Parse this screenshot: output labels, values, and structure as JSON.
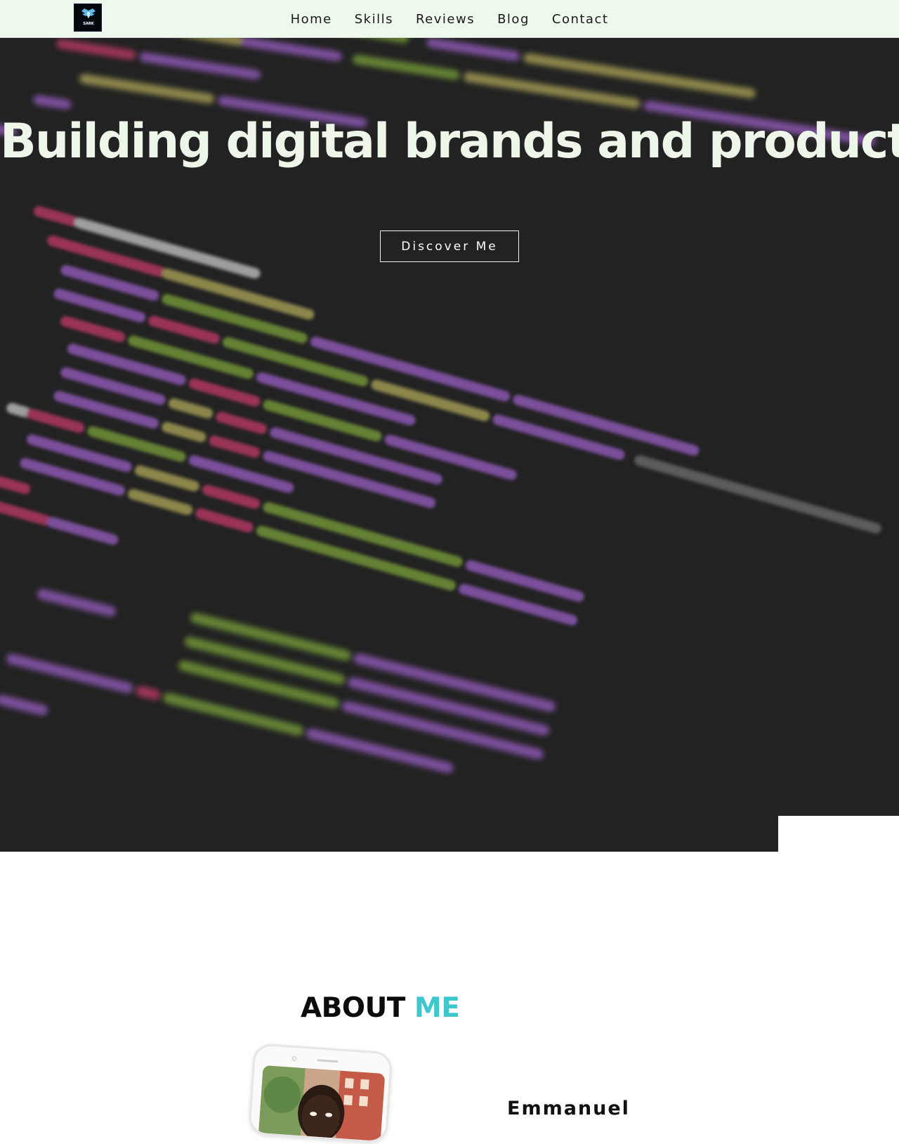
{
  "nav": {
    "logo_icon": "logo-icon",
    "links": [
      "Home",
      "Skills",
      "Reviews",
      "Blog",
      "Contact"
    ]
  },
  "hero": {
    "title": "Building digital brands and products",
    "cta_label": "Discover Me",
    "background": "blurred-code-image"
  },
  "about": {
    "title_part1": "ABOUT",
    "title_part2": "ME",
    "accent_color": "#3ec7cf",
    "profile_image": "phone-frame-profile-photo",
    "name": "Emmanuel"
  }
}
